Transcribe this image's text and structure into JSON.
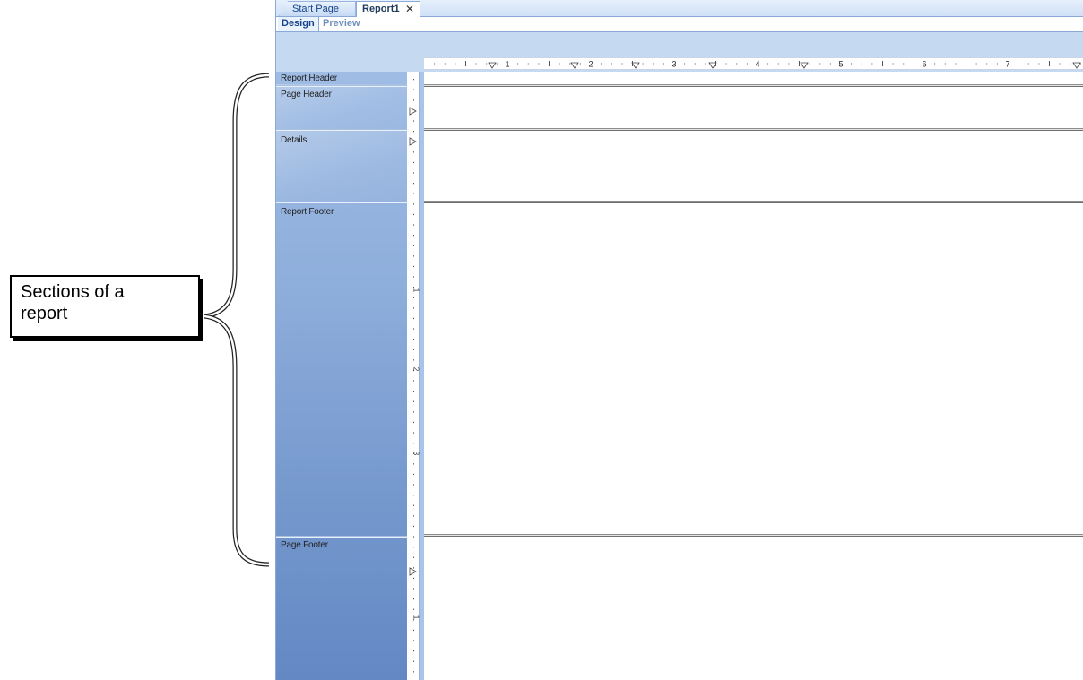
{
  "annotation": {
    "callout_line1": "Sections of a",
    "callout_line2": "report"
  },
  "tabs": [
    {
      "label": "Start Page",
      "active": false
    },
    {
      "label": "Report1",
      "active": true,
      "close_icon": "close-icon"
    }
  ],
  "modes": {
    "design_label": "Design",
    "preview_label": "Preview",
    "selected": "Design"
  },
  "sections": [
    {
      "name": "Report Header"
    },
    {
      "name": "Page Header"
    },
    {
      "name": "Details"
    },
    {
      "name": "Report Footer"
    },
    {
      "name": "Page Footer"
    }
  ],
  "ruler": {
    "horizontal_numbers": [
      "1",
      "2",
      "3",
      "4",
      "5",
      "6",
      "7"
    ],
    "vertical_numbers": [
      "1",
      "2",
      "3",
      "1"
    ]
  },
  "colors": {
    "tab_text": "#15428b",
    "pane_top": "#9fbce4",
    "pane_bottom": "#6388c4"
  }
}
